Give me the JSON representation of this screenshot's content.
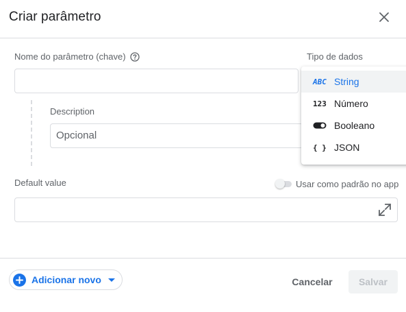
{
  "dialog": {
    "title": "Criar parâmetro"
  },
  "form": {
    "param_name_label": "Nome do parâmetro (chave)",
    "param_name_value": "",
    "data_type_label": "Tipo de dados",
    "description_label": "Description",
    "description_placeholder": "Opcional",
    "default_value_label": "Default value",
    "default_value": "",
    "use_app_default_label": "Usar como padrão no app",
    "use_app_default_on": false
  },
  "data_type_menu": {
    "selected": "String",
    "items": [
      {
        "icon": "ABC",
        "icon_name": "abc-icon",
        "label": "String"
      },
      {
        "icon": "123",
        "icon_name": "number-icon",
        "label": "Número"
      },
      {
        "icon": "",
        "icon_name": "toggle-icon",
        "label": "Booleano"
      },
      {
        "icon": "{ }",
        "icon_name": "braces-icon",
        "label": "JSON"
      }
    ]
  },
  "footer": {
    "add_new_label": "Adicionar novo",
    "cancel_label": "Cancelar",
    "save_label": "Salvar"
  },
  "colors": {
    "accent": "#1a73e8",
    "text": "#202124",
    "muted": "#5f6368",
    "border": "#dadce0",
    "disabled_bg": "#f1f3f4"
  }
}
